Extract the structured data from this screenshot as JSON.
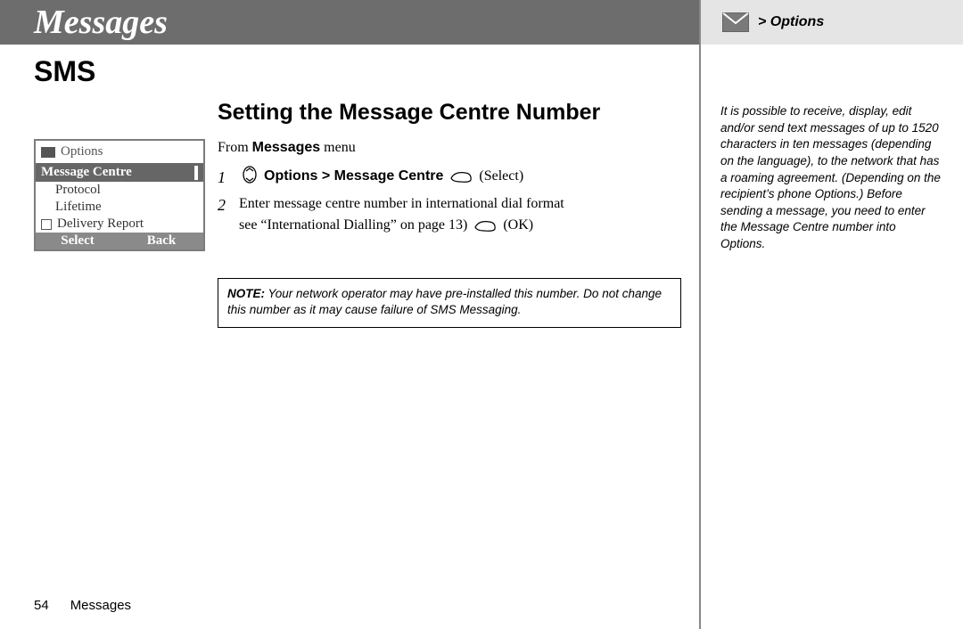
{
  "title": "Messages",
  "section": "SMS",
  "heading": "Setting the Message Centre Number",
  "from_prefix": "From ",
  "from_bold": "Messages",
  "from_suffix": " menu",
  "steps": {
    "s1_num": "1",
    "s1_bold": "Options > Message Centre",
    "s1_tail": " (Select)",
    "s2_num": "2",
    "s2_line1": "Enter message centre number in international dial format",
    "s2_line2_a": "see “International Dialling” on page 13) ",
    "s2_line2_b": " (OK)"
  },
  "note": {
    "label": "NOTE:",
    "text": " Your network operator may have pre-installed this number. Do not change this number as it may cause failure of SMS Messaging."
  },
  "phone": {
    "title": "Options",
    "selected": "Message Centre",
    "item1": "Protocol",
    "item2": "Lifetime",
    "item3": "Delivery Report",
    "left": "Select",
    "right": "Back"
  },
  "sidebar": {
    "crumb": "> Options",
    "body": "It is possible to receive, display, edit and/or send text messages of up to 1520 characters in ten messages (depending on the language), to the network that has a roaming agreement. (Depending on the recipient’s phone Options.) Before sending a message, you need to enter the Message Centre number into Options."
  },
  "footer": {
    "page": "54",
    "label": "Messages"
  }
}
